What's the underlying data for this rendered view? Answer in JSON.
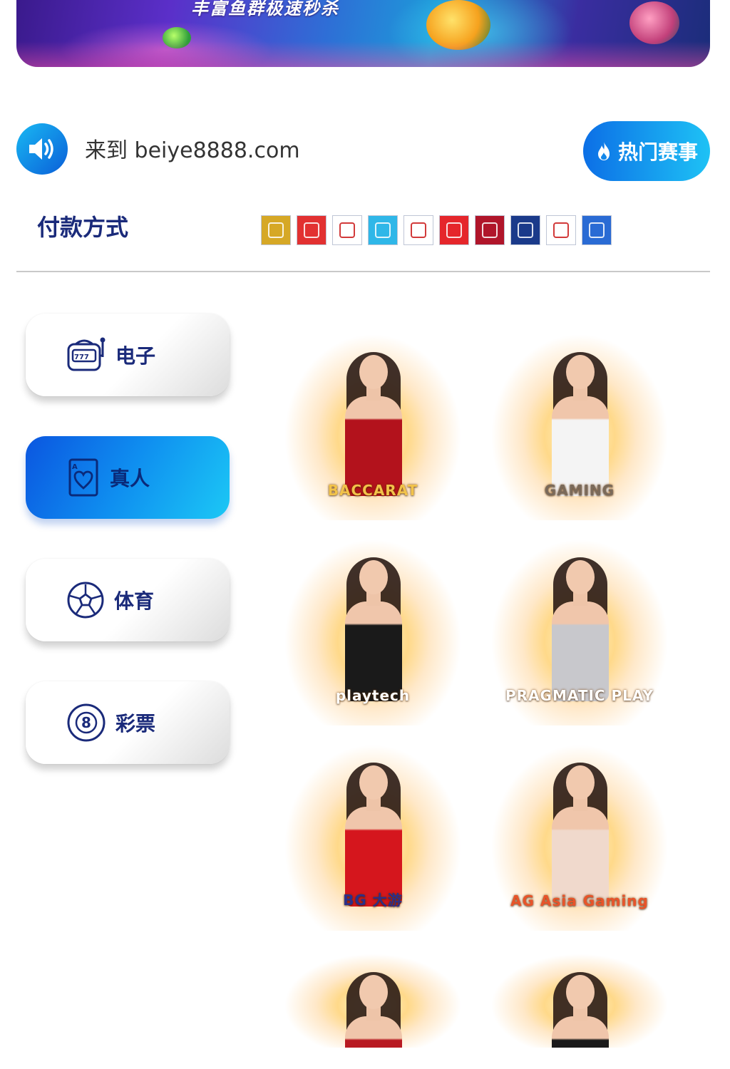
{
  "banner": {
    "caption": "丰富鱼群极速秒杀"
  },
  "notice": {
    "marquee_text": "来到 beiye8888.com",
    "hot_button_label": "热门赛事"
  },
  "payment": {
    "title": "付款方式",
    "logos": [
      {
        "name": "payment-logo-1",
        "color": "#d6a826"
      },
      {
        "name": "payment-logo-2",
        "color": "#e23131"
      },
      {
        "name": "payment-logo-3",
        "color": "#ffffff"
      },
      {
        "name": "payment-logo-4",
        "color": "#2fb7e8"
      },
      {
        "name": "payment-logo-5",
        "color": "#ffffff"
      },
      {
        "name": "payment-logo-6",
        "color": "#e5262b"
      },
      {
        "name": "payment-logo-7",
        "color": "#b0152a"
      },
      {
        "name": "payment-logo-8",
        "color": "#1a3a8a"
      },
      {
        "name": "payment-logo-9",
        "color": "#ffffff"
      },
      {
        "name": "payment-logo-10",
        "color": "#2a6bd4"
      }
    ]
  },
  "categories": [
    {
      "label": "电子",
      "icon": "slot-machine-icon",
      "active": false
    },
    {
      "label": "真人",
      "icon": "playing-card-heart-icon",
      "active": true
    },
    {
      "label": "体育",
      "icon": "soccer-ball-icon",
      "active": false
    },
    {
      "label": "彩票",
      "icon": "lottery-ball-icon",
      "active": false
    }
  ],
  "games": [
    {
      "brand": "BACCARAT",
      "brand_color": "#f2c34a",
      "dress_color": "#b3121c"
    },
    {
      "brand": "GAMING",
      "brand_color": "#7a6a5a",
      "dress_color": "#f4f4f4"
    },
    {
      "brand": "playtech",
      "brand_color": "#ffffff",
      "dress_color": "#1a1a1a"
    },
    {
      "brand": "PRAGMATIC PLAY",
      "brand_color": "#ffffff",
      "dress_color": "#c8c8cc"
    },
    {
      "brand": "BG 大游",
      "brand_color": "#2b2f8a",
      "dress_color": "#d5161d"
    },
    {
      "brand": "AG Asia Gaming",
      "brand_color": "#e8542a",
      "dress_color": "#f0d9cc"
    },
    {
      "brand": "",
      "brand_color": "#ffffff",
      "dress_color": "#b81a22"
    },
    {
      "brand": "",
      "brand_color": "#ffffff",
      "dress_color": "#1a1a1a"
    }
  ]
}
